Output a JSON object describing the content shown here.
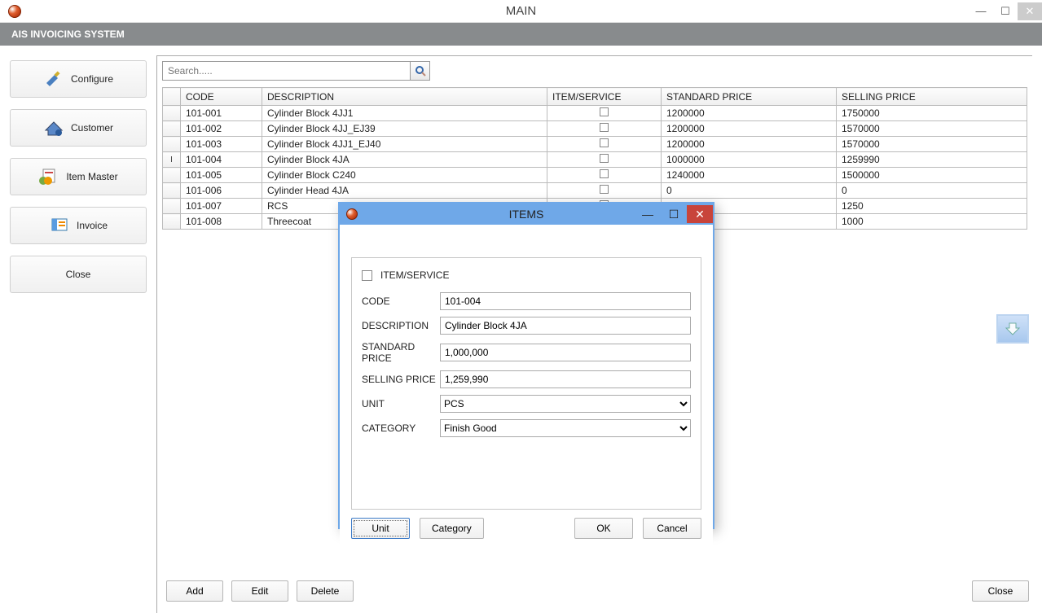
{
  "window": {
    "title": "MAIN"
  },
  "menubar": {
    "title": "AIS INVOICING SYSTEM"
  },
  "sidebar": {
    "configure": "Configure",
    "customer": "Customer",
    "itemmaster": "Item Master",
    "invoice": "Invoice",
    "close": "Close"
  },
  "search": {
    "placeholder": "Search....."
  },
  "columns": {
    "code": "CODE",
    "description": "DESCRIPTION",
    "itemservice": "ITEM/SERVICE",
    "standard": "STANDARD PRICE",
    "selling": "SELLING PRICE"
  },
  "rows": [
    {
      "marker": "",
      "code": "101-001",
      "desc": "Cylinder Block 4JJ1",
      "std": "1200000",
      "sell": "1750000"
    },
    {
      "marker": "",
      "code": "101-002",
      "desc": "Cylinder Block 4JJ_EJ39",
      "std": "1200000",
      "sell": "1570000"
    },
    {
      "marker": "",
      "code": "101-003",
      "desc": "Cylinder Block 4JJ1_EJ40",
      "std": "1200000",
      "sell": "1570000"
    },
    {
      "marker": "I",
      "code": "101-004",
      "desc": "Cylinder Block 4JA",
      "std": "1000000",
      "sell": "1259990"
    },
    {
      "marker": "",
      "code": "101-005",
      "desc": "Cylinder Block C240",
      "std": "1240000",
      "sell": "1500000"
    },
    {
      "marker": "",
      "code": "101-006",
      "desc": "Cylinder Head 4JA",
      "std": "0",
      "sell": "0"
    },
    {
      "marker": "",
      "code": "101-007",
      "desc": "RCS",
      "std": "",
      "sell": "1250"
    },
    {
      "marker": "",
      "code": "101-008",
      "desc": "Threecoat",
      "std": "",
      "sell": "1000"
    }
  ],
  "bottom": {
    "add": "Add",
    "edit": "Edit",
    "delete": "Delete",
    "close": "Close"
  },
  "dialog": {
    "title": "ITEMS",
    "itemservice_label": "ITEM/SERVICE",
    "code_label": "CODE",
    "code_value": "101-004",
    "desc_label": "DESCRIPTION",
    "desc_value": "Cylinder Block 4JA",
    "std_label": "STANDARD PRICE",
    "std_value": "1,000,000",
    "sell_label": "SELLING PRICE",
    "sell_value": "1,259,990",
    "unit_label": "UNIT",
    "unit_value": "PCS",
    "cat_label": "CATEGORY",
    "cat_value": "Finish Good",
    "btn_unit": "Unit",
    "btn_category": "Category",
    "btn_ok": "OK",
    "btn_cancel": "Cancel"
  }
}
